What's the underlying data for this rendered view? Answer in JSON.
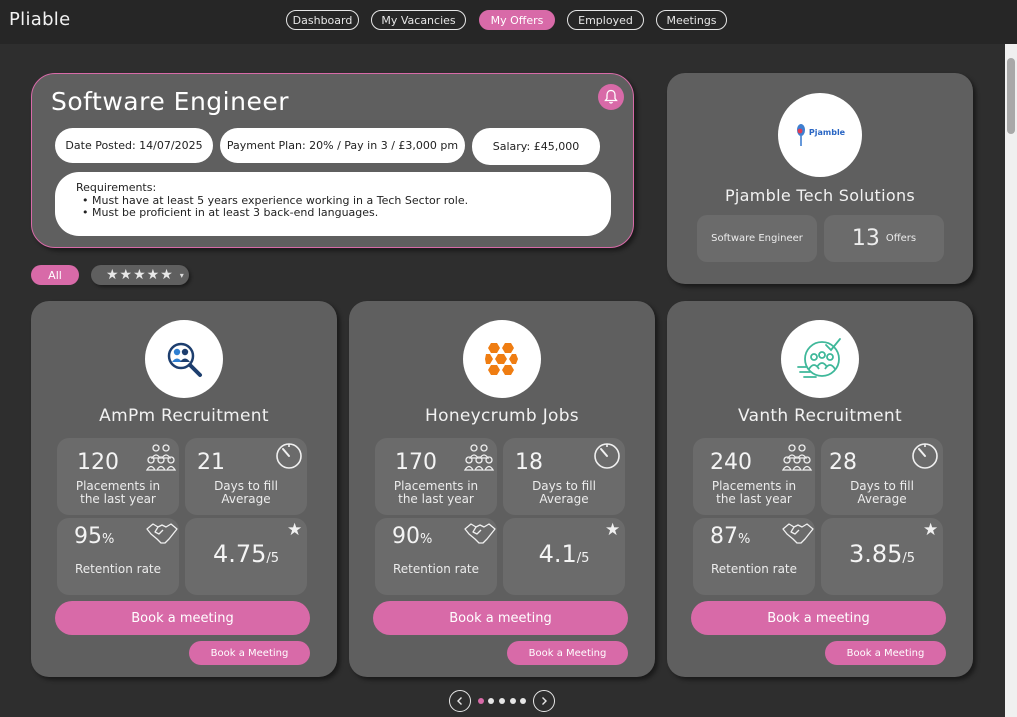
{
  "app": {
    "title": "Pliable"
  },
  "nav": {
    "items": [
      {
        "label": "Dashboard"
      },
      {
        "label": "My Vacancies"
      },
      {
        "label": "My Offers",
        "active": true
      },
      {
        "label": "Employed"
      },
      {
        "label": "Meetings"
      }
    ]
  },
  "job": {
    "title": "Software Engineer",
    "date_posted": "Date Posted: 14/07/2025",
    "payment_plan": "Payment Plan: 20% / Pay in 3 / £3,000 pm",
    "salary": "Salary: £45,000",
    "requirements_heading": "Requirements:",
    "requirements": [
      "Must have at least 5 years experience working in a Tech Sector role.",
      "Must be proficient in at least 3 back-end languages."
    ]
  },
  "filters": {
    "all_label": "All",
    "stars_label": "★★★★★",
    "caret": "▾"
  },
  "company": {
    "logo_text": "Pjamble",
    "name": "Pjamble Tech Solutions",
    "role": "Software Engineer",
    "offers_count": "13",
    "offers_label": "Offers"
  },
  "agencies": [
    {
      "name": "AmPm Recruitment",
      "logo_icon": "people-search-icon",
      "placements": "120",
      "placements_label_1": "Placements in",
      "placements_label_2": "the last year",
      "days_to_fill": "21",
      "days_label_1": "Days to fill",
      "days_label_2": "Average",
      "retention": "95",
      "retention_unit": "%",
      "retention_label": "Retention rate",
      "rating": "4.75",
      "rating_den": "/5",
      "book_main": "Book a meeting",
      "book_small": "Book a Meeting"
    },
    {
      "name": "Honeycrumb Jobs",
      "logo_icon": "honeycomb-icon",
      "placements": "170",
      "placements_label_1": "Placements in",
      "placements_label_2": "the last year",
      "days_to_fill": "18",
      "days_label_1": "Days to fill",
      "days_label_2": "Average",
      "retention": "90",
      "retention_unit": "%",
      "retention_label": "Retention rate",
      "rating": "4.1",
      "rating_den": "/5",
      "book_main": "Book a meeting",
      "book_small": "Book a Meeting"
    },
    {
      "name": "Vanth Recruitment",
      "logo_icon": "team-check-icon",
      "placements": "240",
      "placements_label_1": "Placements in",
      "placements_label_2": "the last year",
      "days_to_fill": "28",
      "days_label_1": "Days to fill",
      "days_label_2": "Average",
      "retention": "87",
      "retention_unit": "%",
      "retention_label": "Retention rate",
      "rating": "3.85",
      "rating_den": "/5",
      "book_main": "Book a meeting",
      "book_small": "Book a Meeting"
    }
  ],
  "pager": {
    "pages": 5,
    "current": 1,
    "prev_icon": "chevron-left-icon",
    "next_icon": "chevron-right-icon"
  },
  "colors": {
    "accent": "#d86aa8",
    "background": "#2e2e2e",
    "card": "#5f5f5f",
    "stat": "#6b6b6b"
  }
}
